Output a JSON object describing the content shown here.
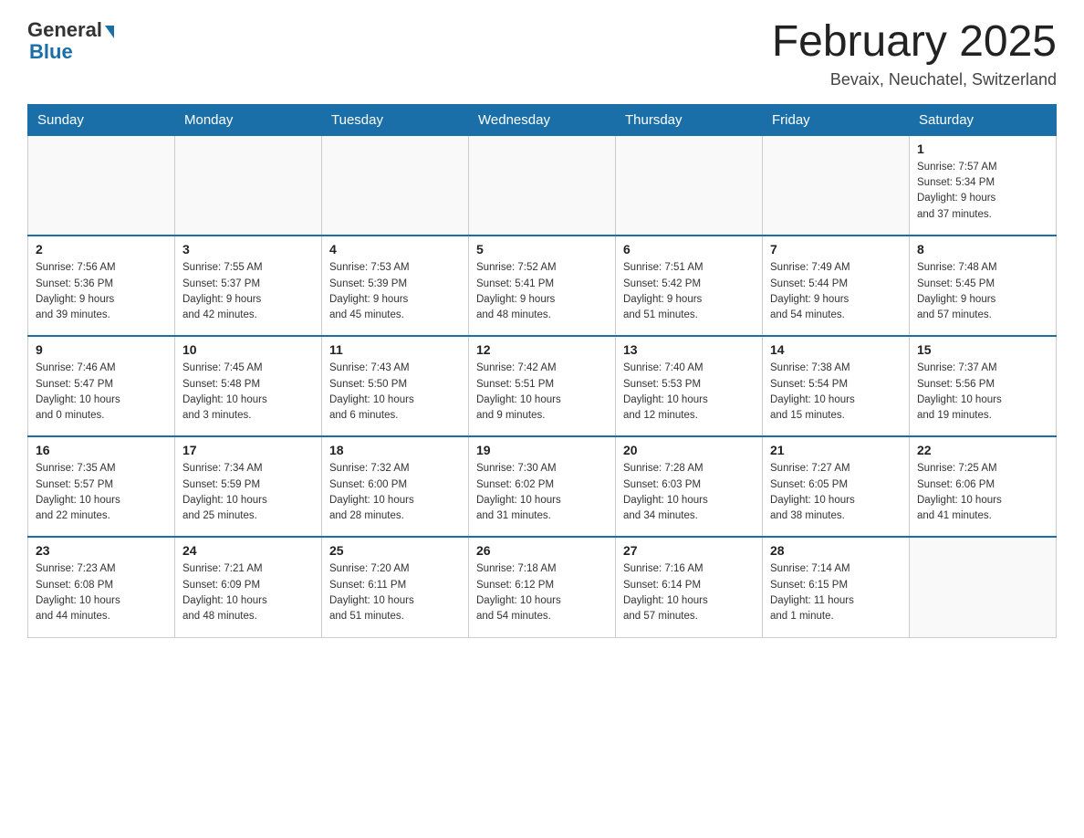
{
  "header": {
    "logo_general": "General",
    "logo_blue": "Blue",
    "month_title": "February 2025",
    "location": "Bevaix, Neuchatel, Switzerland"
  },
  "days_of_week": [
    "Sunday",
    "Monday",
    "Tuesday",
    "Wednesday",
    "Thursday",
    "Friday",
    "Saturday"
  ],
  "weeks": [
    [
      {
        "day": "",
        "info": ""
      },
      {
        "day": "",
        "info": ""
      },
      {
        "day": "",
        "info": ""
      },
      {
        "day": "",
        "info": ""
      },
      {
        "day": "",
        "info": ""
      },
      {
        "day": "",
        "info": ""
      },
      {
        "day": "1",
        "info": "Sunrise: 7:57 AM\nSunset: 5:34 PM\nDaylight: 9 hours\nand 37 minutes."
      }
    ],
    [
      {
        "day": "2",
        "info": "Sunrise: 7:56 AM\nSunset: 5:36 PM\nDaylight: 9 hours\nand 39 minutes."
      },
      {
        "day": "3",
        "info": "Sunrise: 7:55 AM\nSunset: 5:37 PM\nDaylight: 9 hours\nand 42 minutes."
      },
      {
        "day": "4",
        "info": "Sunrise: 7:53 AM\nSunset: 5:39 PM\nDaylight: 9 hours\nand 45 minutes."
      },
      {
        "day": "5",
        "info": "Sunrise: 7:52 AM\nSunset: 5:41 PM\nDaylight: 9 hours\nand 48 minutes."
      },
      {
        "day": "6",
        "info": "Sunrise: 7:51 AM\nSunset: 5:42 PM\nDaylight: 9 hours\nand 51 minutes."
      },
      {
        "day": "7",
        "info": "Sunrise: 7:49 AM\nSunset: 5:44 PM\nDaylight: 9 hours\nand 54 minutes."
      },
      {
        "day": "8",
        "info": "Sunrise: 7:48 AM\nSunset: 5:45 PM\nDaylight: 9 hours\nand 57 minutes."
      }
    ],
    [
      {
        "day": "9",
        "info": "Sunrise: 7:46 AM\nSunset: 5:47 PM\nDaylight: 10 hours\nand 0 minutes."
      },
      {
        "day": "10",
        "info": "Sunrise: 7:45 AM\nSunset: 5:48 PM\nDaylight: 10 hours\nand 3 minutes."
      },
      {
        "day": "11",
        "info": "Sunrise: 7:43 AM\nSunset: 5:50 PM\nDaylight: 10 hours\nand 6 minutes."
      },
      {
        "day": "12",
        "info": "Sunrise: 7:42 AM\nSunset: 5:51 PM\nDaylight: 10 hours\nand 9 minutes."
      },
      {
        "day": "13",
        "info": "Sunrise: 7:40 AM\nSunset: 5:53 PM\nDaylight: 10 hours\nand 12 minutes."
      },
      {
        "day": "14",
        "info": "Sunrise: 7:38 AM\nSunset: 5:54 PM\nDaylight: 10 hours\nand 15 minutes."
      },
      {
        "day": "15",
        "info": "Sunrise: 7:37 AM\nSunset: 5:56 PM\nDaylight: 10 hours\nand 19 minutes."
      }
    ],
    [
      {
        "day": "16",
        "info": "Sunrise: 7:35 AM\nSunset: 5:57 PM\nDaylight: 10 hours\nand 22 minutes."
      },
      {
        "day": "17",
        "info": "Sunrise: 7:34 AM\nSunset: 5:59 PM\nDaylight: 10 hours\nand 25 minutes."
      },
      {
        "day": "18",
        "info": "Sunrise: 7:32 AM\nSunset: 6:00 PM\nDaylight: 10 hours\nand 28 minutes."
      },
      {
        "day": "19",
        "info": "Sunrise: 7:30 AM\nSunset: 6:02 PM\nDaylight: 10 hours\nand 31 minutes."
      },
      {
        "day": "20",
        "info": "Sunrise: 7:28 AM\nSunset: 6:03 PM\nDaylight: 10 hours\nand 34 minutes."
      },
      {
        "day": "21",
        "info": "Sunrise: 7:27 AM\nSunset: 6:05 PM\nDaylight: 10 hours\nand 38 minutes."
      },
      {
        "day": "22",
        "info": "Sunrise: 7:25 AM\nSunset: 6:06 PM\nDaylight: 10 hours\nand 41 minutes."
      }
    ],
    [
      {
        "day": "23",
        "info": "Sunrise: 7:23 AM\nSunset: 6:08 PM\nDaylight: 10 hours\nand 44 minutes."
      },
      {
        "day": "24",
        "info": "Sunrise: 7:21 AM\nSunset: 6:09 PM\nDaylight: 10 hours\nand 48 minutes."
      },
      {
        "day": "25",
        "info": "Sunrise: 7:20 AM\nSunset: 6:11 PM\nDaylight: 10 hours\nand 51 minutes."
      },
      {
        "day": "26",
        "info": "Sunrise: 7:18 AM\nSunset: 6:12 PM\nDaylight: 10 hours\nand 54 minutes."
      },
      {
        "day": "27",
        "info": "Sunrise: 7:16 AM\nSunset: 6:14 PM\nDaylight: 10 hours\nand 57 minutes."
      },
      {
        "day": "28",
        "info": "Sunrise: 7:14 AM\nSunset: 6:15 PM\nDaylight: 11 hours\nand 1 minute."
      },
      {
        "day": "",
        "info": ""
      }
    ]
  ]
}
